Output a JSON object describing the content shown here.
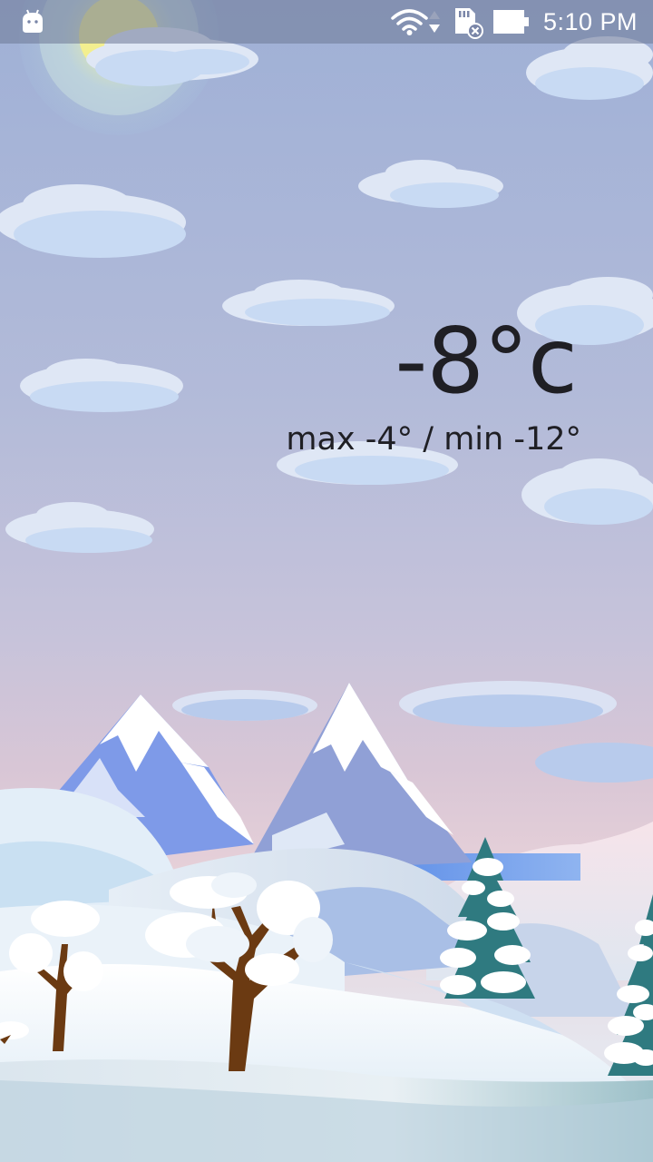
{
  "status_bar": {
    "time": "5:10 PM",
    "icons": [
      "android-icon",
      "wifi-icon",
      "data-arrows-icon",
      "sd-card-error-icon",
      "battery-icon"
    ]
  },
  "weather": {
    "current_temp": "-8°c",
    "range_text": "max -4° / min -12°"
  },
  "scene": {
    "description_icons": [
      "sun-icon",
      "cloud-icon",
      "mountain-icon",
      "hill-icon",
      "snowy-tree-icon",
      "pine-tree-icon"
    ],
    "colors": {
      "sky_top": "#9fb0d6",
      "sky_horizon": "#e6d0d8",
      "snow": "#f4f8fb",
      "mountain_blue": "#7f9be6",
      "pine_green": "#2f7a80",
      "trunk_brown": "#6b3a12"
    }
  }
}
